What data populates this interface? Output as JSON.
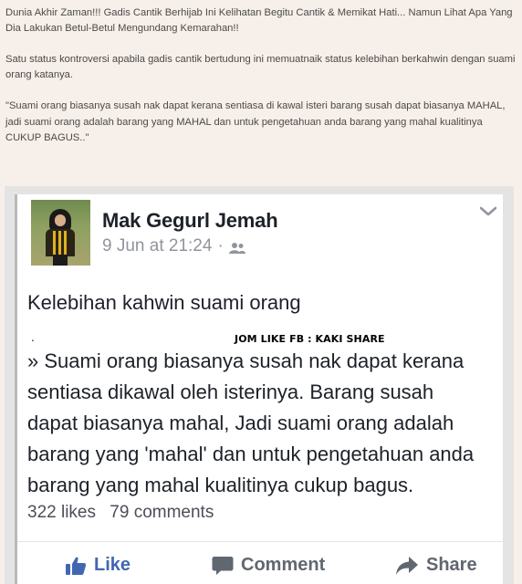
{
  "article": {
    "p1": "Dunia Akhir Zaman!!! Gadis Cantik Berhijab Ini Kelihatan Begitu Cantik & Memikat Hati... Namun Lihat Apa Yang Dia Lakukan Betul-Betul Mengundang Kemarahan!!",
    "p2": "Satu status kontroversi apabila gadis cantik bertudung ini memuatnaik status kelebihan berkahwin dengan suami orang katanya.",
    "p3": "\"Suami orang biasanya susah nak dapat kerana sentiasa di kawal isteri barang susah dapat biasanya MAHAL, jadi suami orang adalah barang yang MAHAL dan untuk pengetahuan anda barang yang mahal kualitinya CUKUP BAGUS..\""
  },
  "post": {
    "author": "Mak Gegurl Jemah",
    "date": "9 Jun at 21:24",
    "dot": "·",
    "title": "Kelebihan kahwin suami orang",
    "small_dot": ".",
    "watermark": "JOM LIKE FB : KAKI SHARE",
    "body_lines": [
      "» Suami orang biasanya susah nak dapat kerana",
      "sentiasa dikawal oleh isterinya. Barang susah",
      "dapat biasanya mahal, Jadi suami orang adalah",
      "barang yang 'mahal' dan untuk pengetahuan anda",
      "barang yang mahal kualitinya cukup bagus."
    ],
    "likes": "322 likes",
    "comments": "79 comments"
  },
  "actions": {
    "like": "Like",
    "comment": "Comment",
    "share": "Share"
  },
  "colors": {
    "page_bg": "#f7efe9",
    "fb_blue": "#4267b2",
    "muted": "#90949c"
  },
  "icons": [
    "chevron-down-icon",
    "friends-icon",
    "thumbs-up-icon",
    "comment-icon",
    "share-icon"
  ]
}
